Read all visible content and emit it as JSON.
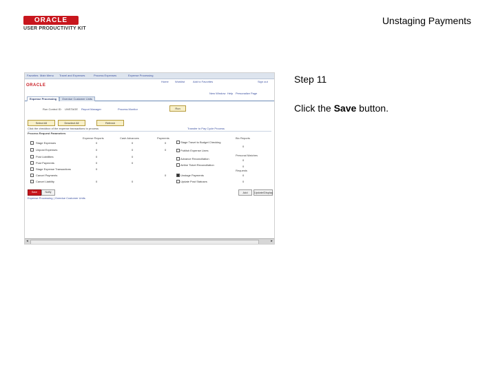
{
  "header": {
    "logo_text": "ORACLE",
    "logo_subtext": "USER PRODUCTIVITY KIT",
    "doc_title": "Unstaging Payments"
  },
  "step": {
    "label": "Step 11",
    "instruction_prefix": "Click the ",
    "instruction_bold": "Save",
    "instruction_suffix": " button."
  },
  "app": {
    "topnav": [
      "Favorites",
      "Main Menu",
      "Travel and Expenses",
      "Process Expenses",
      "Expense Processing"
    ],
    "toplinks": [
      "Home",
      "Worklist",
      "Add to Favorites",
      "Sign out"
    ],
    "logo": "ORACLE",
    "subnav": [
      "New Window",
      "Help",
      "Personalize Page"
    ],
    "tabs": [
      "Expense Processing",
      "Overdue Customer Units"
    ],
    "run_control_label": "Run Control ID:",
    "run_control_value": "UNSTAGE",
    "report_manager": "Report Manager",
    "process_monitor": "Process Monitor",
    "run_button": "Run",
    "select_all": "Select All",
    "deselect_all": "Deselect All",
    "refresh": "Refresh",
    "instruction": "Click the checkbox of the expense transactions to process",
    "transfer_link": "Transfer to Pay Cycle Process",
    "section_title": "Process Request Parameters",
    "columns": [
      "Expense Reports",
      "Cash Advances",
      "Payments",
      "Bio Reports"
    ],
    "rows_left": [
      {
        "label": "Stage Expenses",
        "v1": "0",
        "v2": "0",
        "v3": "0"
      },
      {
        "label": "Unpost Expenses",
        "v1": "0",
        "v2": "0",
        "v3": "0"
      },
      {
        "label": "Post Liabilities",
        "v1": "0",
        "v2": "0",
        "v3": ""
      },
      {
        "label": "Post Payments",
        "v1": "0",
        "v2": "0",
        "v3": ""
      },
      {
        "label": "Stage Expense Transactions",
        "v1": "0",
        "v2": "",
        "v3": ""
      },
      {
        "label": "Cancel Payments",
        "v1": "",
        "v2": "",
        "v3": "0"
      },
      {
        "label": "Cancel Liability",
        "v1": "0",
        "v2": "0",
        "v3": ""
      }
    ],
    "rows_right": [
      {
        "label": "Stage Travel to Budget Checking",
        "v": "0"
      },
      {
        "label": "Publish Expense Lines",
        "v": ""
      },
      {
        "label": "Advance Reconciliation",
        "v": "0"
      },
      {
        "label": "Airline Ticket Reconciliation",
        "v": "0"
      },
      {
        "label": "Unstage Payments",
        "v": "0"
      },
      {
        "label": "Update Post Statuses",
        "v": "0"
      }
    ],
    "personal_label": "Personal Matches",
    "requests_label": "Requests",
    "save_button": "Save",
    "notify_button": "Notify",
    "add_button": "Add",
    "update_button": "Update/Display",
    "bottom_links": "Expense Processing | Overdue Customer Units"
  }
}
